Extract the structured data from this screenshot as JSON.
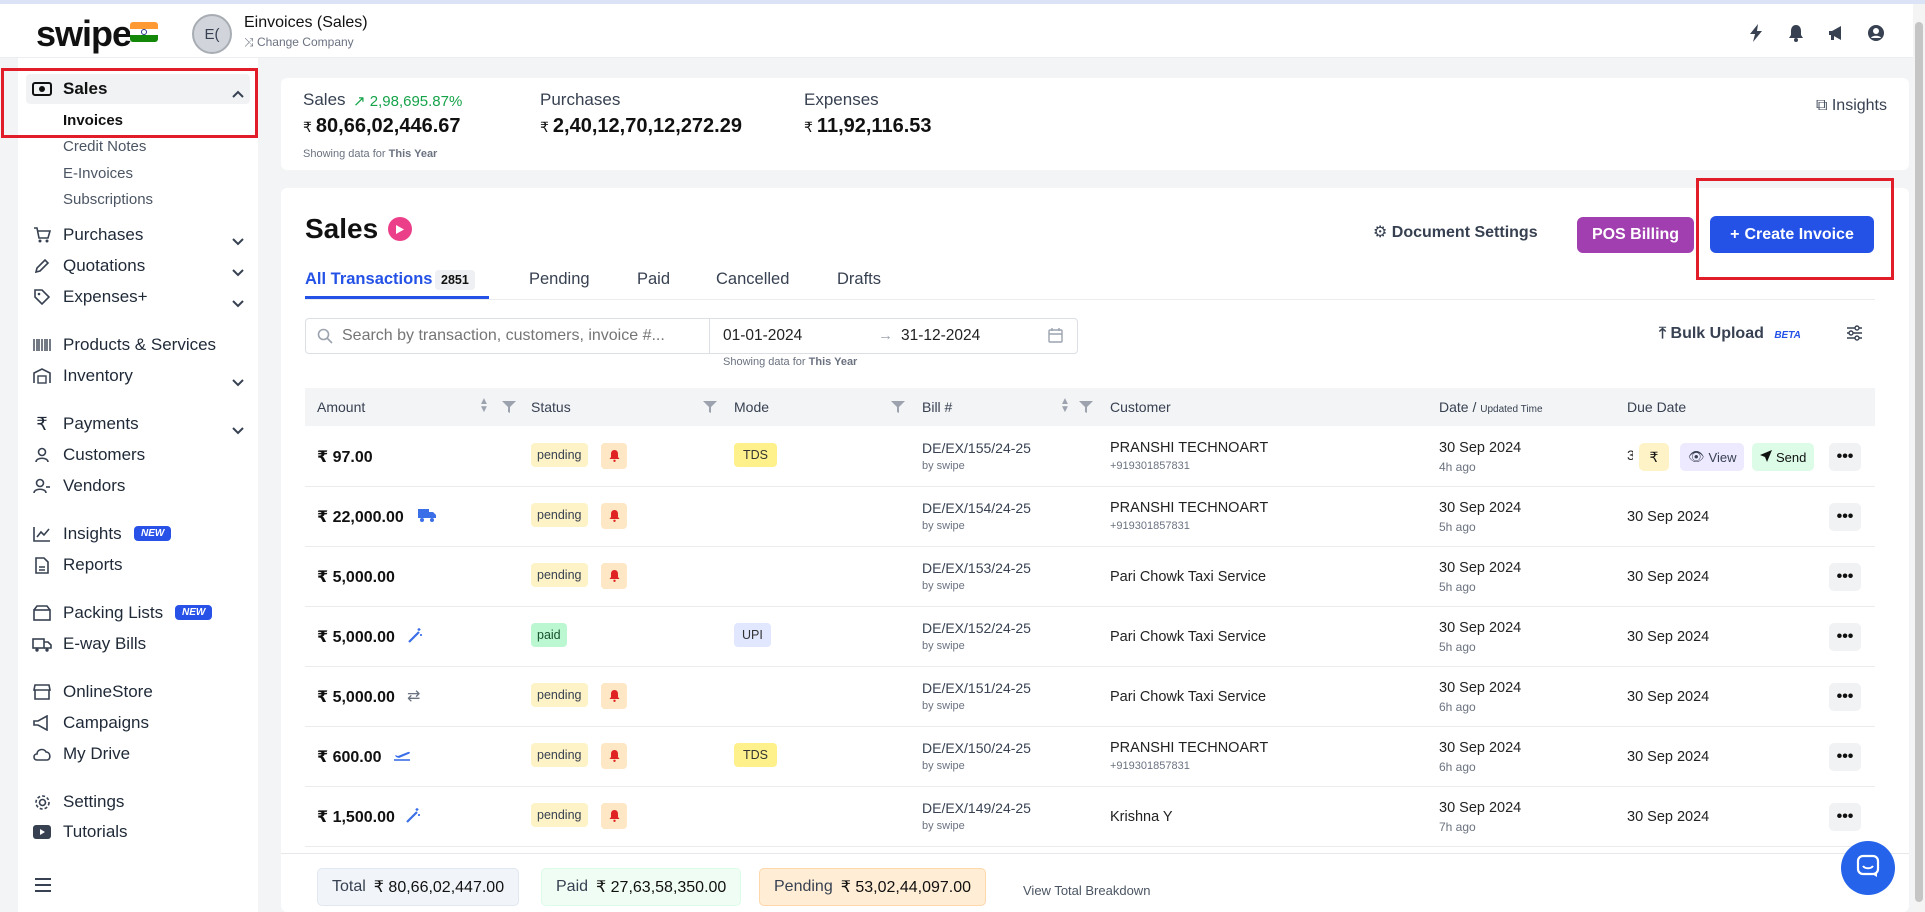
{
  "topbar": {
    "logo": "swipe",
    "company_avatar": "E(",
    "company_name": "Einvoices (Sales)",
    "change_company": "Change Company",
    "icons": [
      "flash-icon",
      "bell-icon",
      "megaphone-icon",
      "user-icon"
    ]
  },
  "sidebar": {
    "sales": "Sales",
    "sales_sub": [
      "Invoices",
      "Credit Notes",
      "E-Invoices",
      "Subscriptions"
    ],
    "purchases": "Purchases",
    "quotations": "Quotations",
    "expenses": "Expenses+",
    "products": "Products & Services",
    "inventory": "Inventory",
    "payments": "Payments",
    "customers": "Customers",
    "vendors": "Vendors",
    "insights": "Insights",
    "insights_badge": "NEW",
    "reports": "Reports",
    "packing": "Packing Lists",
    "packing_badge": "NEW",
    "eway": "E-way Bills",
    "onlinestore": "OnlineStore",
    "campaigns": "Campaigns",
    "mydrive": "My Drive",
    "settings": "Settings",
    "tutorials": "Tutorials"
  },
  "stats": {
    "sales_label": "Sales",
    "sales_growth": "2,98,695.87%",
    "sales_value": "80,66,02,446.67",
    "purchases_label": "Purchases",
    "purchases_value": "2,40,12,70,12,272.29",
    "expenses_label": "Expenses",
    "expenses_value": "11,92,116.53",
    "showing_prefix": "Showing data for",
    "showing_period": "This Year",
    "insights_link": "Insights",
    "currency": "₹"
  },
  "main": {
    "title": "Sales",
    "document_settings": "Document Settings",
    "pos_billing": "POS Billing",
    "create_invoice": "Create Invoice",
    "tabs": [
      "All Transactions",
      "Pending",
      "Paid",
      "Cancelled",
      "Drafts"
    ],
    "all_count": "2851",
    "search_placeholder": "Search by transaction, customers, invoice #...",
    "date_from": "01-01-2024",
    "date_to": "31-12-2024",
    "showing_prefix": "Showing data for",
    "showing_period": "This Year",
    "bulk_upload": "Bulk Upload",
    "beta": "BETA"
  },
  "table": {
    "headers": {
      "amount": "Amount",
      "status": "Status",
      "mode": "Mode",
      "bill": "Bill #",
      "customer": "Customer",
      "date": "Date /",
      "date_sub": "Updated Time",
      "due": "Due Date"
    },
    "rows": [
      {
        "amount": "₹ 97.00",
        "status": "pending",
        "mode": "TDS",
        "bill": "DE/EX/155/24-25",
        "by": "by swipe",
        "customer": "PRANSHI TECHNOART",
        "phone": "+919301857831",
        "date": "30 Sep 2024",
        "ago": "4h ago",
        "due": ""
      },
      {
        "amount": "₹ 22,000.00",
        "status": "pending",
        "mode": "",
        "bill": "DE/EX/154/24-25",
        "by": "by swipe",
        "customer": "PRANSHI TECHNOART",
        "phone": "+919301857831",
        "date": "30 Sep 2024",
        "ago": "5h ago",
        "due": "30 Sep 2024"
      },
      {
        "amount": "₹ 5,000.00",
        "status": "pending",
        "mode": "",
        "bill": "DE/EX/153/24-25",
        "by": "by swipe",
        "customer": "Pari Chowk Taxi Service",
        "phone": "",
        "date": "30 Sep 2024",
        "ago": "5h ago",
        "due": "30 Sep 2024"
      },
      {
        "amount": "₹ 5,000.00",
        "status": "paid",
        "mode": "UPI",
        "bill": "DE/EX/152/24-25",
        "by": "by swipe",
        "customer": "Pari Chowk Taxi Service",
        "phone": "",
        "date": "30 Sep 2024",
        "ago": "5h ago",
        "due": "30 Sep 2024"
      },
      {
        "amount": "₹ 5,000.00",
        "status": "pending",
        "mode": "",
        "bill": "DE/EX/151/24-25",
        "by": "by swipe",
        "customer": "Pari Chowk Taxi Service",
        "phone": "",
        "date": "30 Sep 2024",
        "ago": "6h ago",
        "due": "30 Sep 2024"
      },
      {
        "amount": "₹ 600.00",
        "status": "pending",
        "mode": "TDS",
        "bill": "DE/EX/150/24-25",
        "by": "by swipe",
        "customer": "PRANSHI TECHNOART",
        "phone": "+919301857831",
        "date": "30 Sep 2024",
        "ago": "6h ago",
        "due": "30 Sep 2024"
      },
      {
        "amount": "₹ 1,500.00",
        "status": "pending",
        "mode": "",
        "bill": "DE/EX/149/24-25",
        "by": "by swipe",
        "customer": "Krishna Y",
        "phone": "",
        "date": "30 Sep 2024",
        "ago": "7h ago",
        "due": "30 Sep 2024"
      }
    ],
    "row1_actions": {
      "partial": "3",
      "rupee": "₹",
      "view": "View",
      "send": "Send"
    }
  },
  "footer": {
    "total_label": "Total",
    "total_value": "₹ 80,66,02,447.00",
    "paid_label": "Paid",
    "paid_value": "₹ 27,63,58,350.00",
    "pending_label": "Pending",
    "pending_value": "₹ 53,02,44,097.00",
    "breakdown": "View Total Breakdown"
  },
  "colors": {
    "primary": "#2452e6",
    "pos": "#a13fb0",
    "highlight": "#e11d2a",
    "growth": "#16a34a"
  }
}
